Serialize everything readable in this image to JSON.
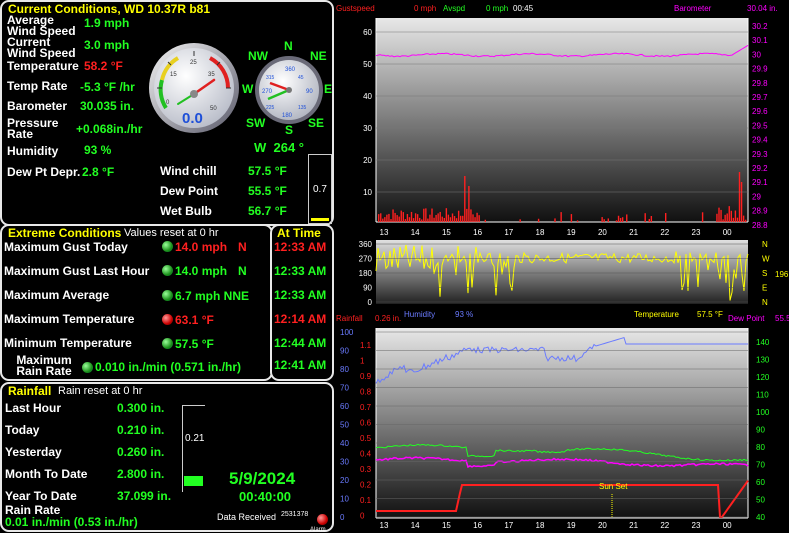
{
  "current": {
    "title": "Current Conditions, WD 10.37R b81",
    "rows": [
      {
        "label": "Average Wind Speed",
        "value": "1.9 mph"
      },
      {
        "label": "Current Wind Speed",
        "value": "3.0 mph"
      },
      {
        "label": "Temperature",
        "value": "58.2 °F"
      },
      {
        "label": "Temp Rate",
        "value": "-5.3 °F /hr"
      },
      {
        "label": "Barometer",
        "value": "30.035 in."
      },
      {
        "label": "Pressure Rate",
        "value": "+0.068in./hr"
      },
      {
        "label": "Humidity",
        "value": "93 %"
      },
      {
        "label": "Dew Pt Depr.",
        "value": "2.8 °F"
      }
    ],
    "wind_chill_label": "Wind chill",
    "wind_chill": "57.5 °F",
    "dew_point_label": "Dew Point",
    "dew_point": "55.5 °F",
    "wet_bulb_label": "Wet Bulb",
    "wet_bulb": "56.7 °F",
    "speedo_value": "0.0",
    "speedo_ticks": [
      "5",
      "10",
      "15",
      "20",
      "25",
      "30",
      "35",
      "40",
      "45",
      "50"
    ],
    "compass": {
      "N": "N",
      "NE": "NE",
      "E": "E",
      "SE": "SE",
      "S": "S",
      "SW": "SW",
      "W": "W",
      "NW": "NW",
      "ticks": [
        "45",
        "90",
        "135",
        "180",
        "225",
        "270",
        "315"
      ]
    },
    "wind_dir": "W  264 °",
    "side_box_value": "0.7"
  },
  "extreme": {
    "title": "Extreme Conditions",
    "subtitle": "Values reset at 0 hr",
    "time_title": "At Time",
    "rows": [
      {
        "label": "Maximum Gust Today",
        "value": "14.0 mph",
        "extra": "N",
        "time": "12:33 AM"
      },
      {
        "label": "Maximum Gust Last Hour",
        "value": "14.0 mph",
        "extra": "N",
        "time": "12:33 AM"
      },
      {
        "label": "Maximum Average",
        "value": "6.7 mph NNE",
        "extra": "",
        "time": "12:33 AM"
      },
      {
        "label": "Maximum Temperature",
        "value": "63.1 °F",
        "extra": "",
        "time": "12:14 AM"
      },
      {
        "label": "Minimum Temperature",
        "value": "57.5 °F",
        "extra": "",
        "time": "12:44 AM"
      },
      {
        "label": "Maximum Rain Rate",
        "value": "0.010 in./min (0.571 in./hr)",
        "extra": "",
        "time": "12:41 AM"
      }
    ]
  },
  "rain": {
    "title": "Rainfall",
    "subtitle": "Rain reset at 0 hr",
    "rows": [
      {
        "label": "Last Hour",
        "value": "0.300 in."
      },
      {
        "label": "Today",
        "value": "0.210 in."
      },
      {
        "label": "Yesterday",
        "value": "0.260 in."
      },
      {
        "label": "Month To Date",
        "value": "2.800 in."
      },
      {
        "label": "Year To Date",
        "value": "37.099 in."
      }
    ],
    "rate_label": "Rain Rate",
    "rate_value": "0.01 in./min (0.53 in./hr)",
    "gauge_value": "0.21",
    "date": "5/9/2024",
    "time": "00:40:00",
    "data_received_label": "Data Received",
    "data_received_count": "2531378",
    "alarm_label": "Alarm"
  },
  "chart_top": {
    "legend_gust": "Gustspeed",
    "legend_gust_val": "0 mph",
    "legend_avg": "Avspd",
    "legend_avg_val": "0 mph",
    "legend_time": "00:45",
    "legend_baro": "Barometer",
    "legend_baro_val": "30.04 in.",
    "left_ticks": [
      "60",
      "50",
      "40",
      "30",
      "20",
      "10"
    ],
    "right_ticks": [
      "30.2",
      "30.1",
      "30",
      "29.9",
      "29.8",
      "29.7",
      "29.6",
      "29.5",
      "29.4",
      "29.3",
      "29.2",
      "29.1",
      "29",
      "28.9",
      "28.8"
    ],
    "x_ticks": [
      "13",
      "14",
      "15",
      "16",
      "17",
      "18",
      "19",
      "20",
      "21",
      "22",
      "23",
      "00"
    ]
  },
  "chart_dir": {
    "left_ticks": [
      "360",
      "270",
      "180",
      "90",
      "0"
    ],
    "right_letters": [
      "N",
      "W",
      "S",
      "E",
      "N"
    ],
    "right_val": "196",
    "humidity_label": "Humidity",
    "humidity_val": "93 %",
    "temp_label": "Temperature",
    "temp_val": "57.5 °F",
    "dew_label": "Dew Point",
    "dew_val": "55.5"
  },
  "chart_bottom": {
    "rain_label": "Rainfall",
    "rain_val": "0.26 in.",
    "left_ticks": [
      "100",
      "90",
      "80",
      "70",
      "60",
      "50",
      "40",
      "30",
      "20",
      "10",
      "0"
    ],
    "right_ticks": [
      "140",
      "130",
      "120",
      "110",
      "100",
      "90",
      "80",
      "70",
      "60",
      "50",
      "40"
    ],
    "x_ticks": [
      "13",
      "14",
      "15",
      "16",
      "17",
      "18",
      "19",
      "20",
      "21",
      "22",
      "23",
      "00"
    ],
    "sunset_label": "Sun Set",
    "mini_ticks": [
      "1.1",
      "1",
      "0.9",
      "0.8",
      "0.7",
      "0.6",
      "0.5",
      "0.4",
      "0.3",
      "0.2",
      "0.1",
      "0"
    ]
  },
  "colors": {
    "green": "#22ff22",
    "yellow": "#ffff00",
    "red": "#ff2020",
    "magenta": "#ff00ff",
    "blue": "#6a7bff"
  }
}
